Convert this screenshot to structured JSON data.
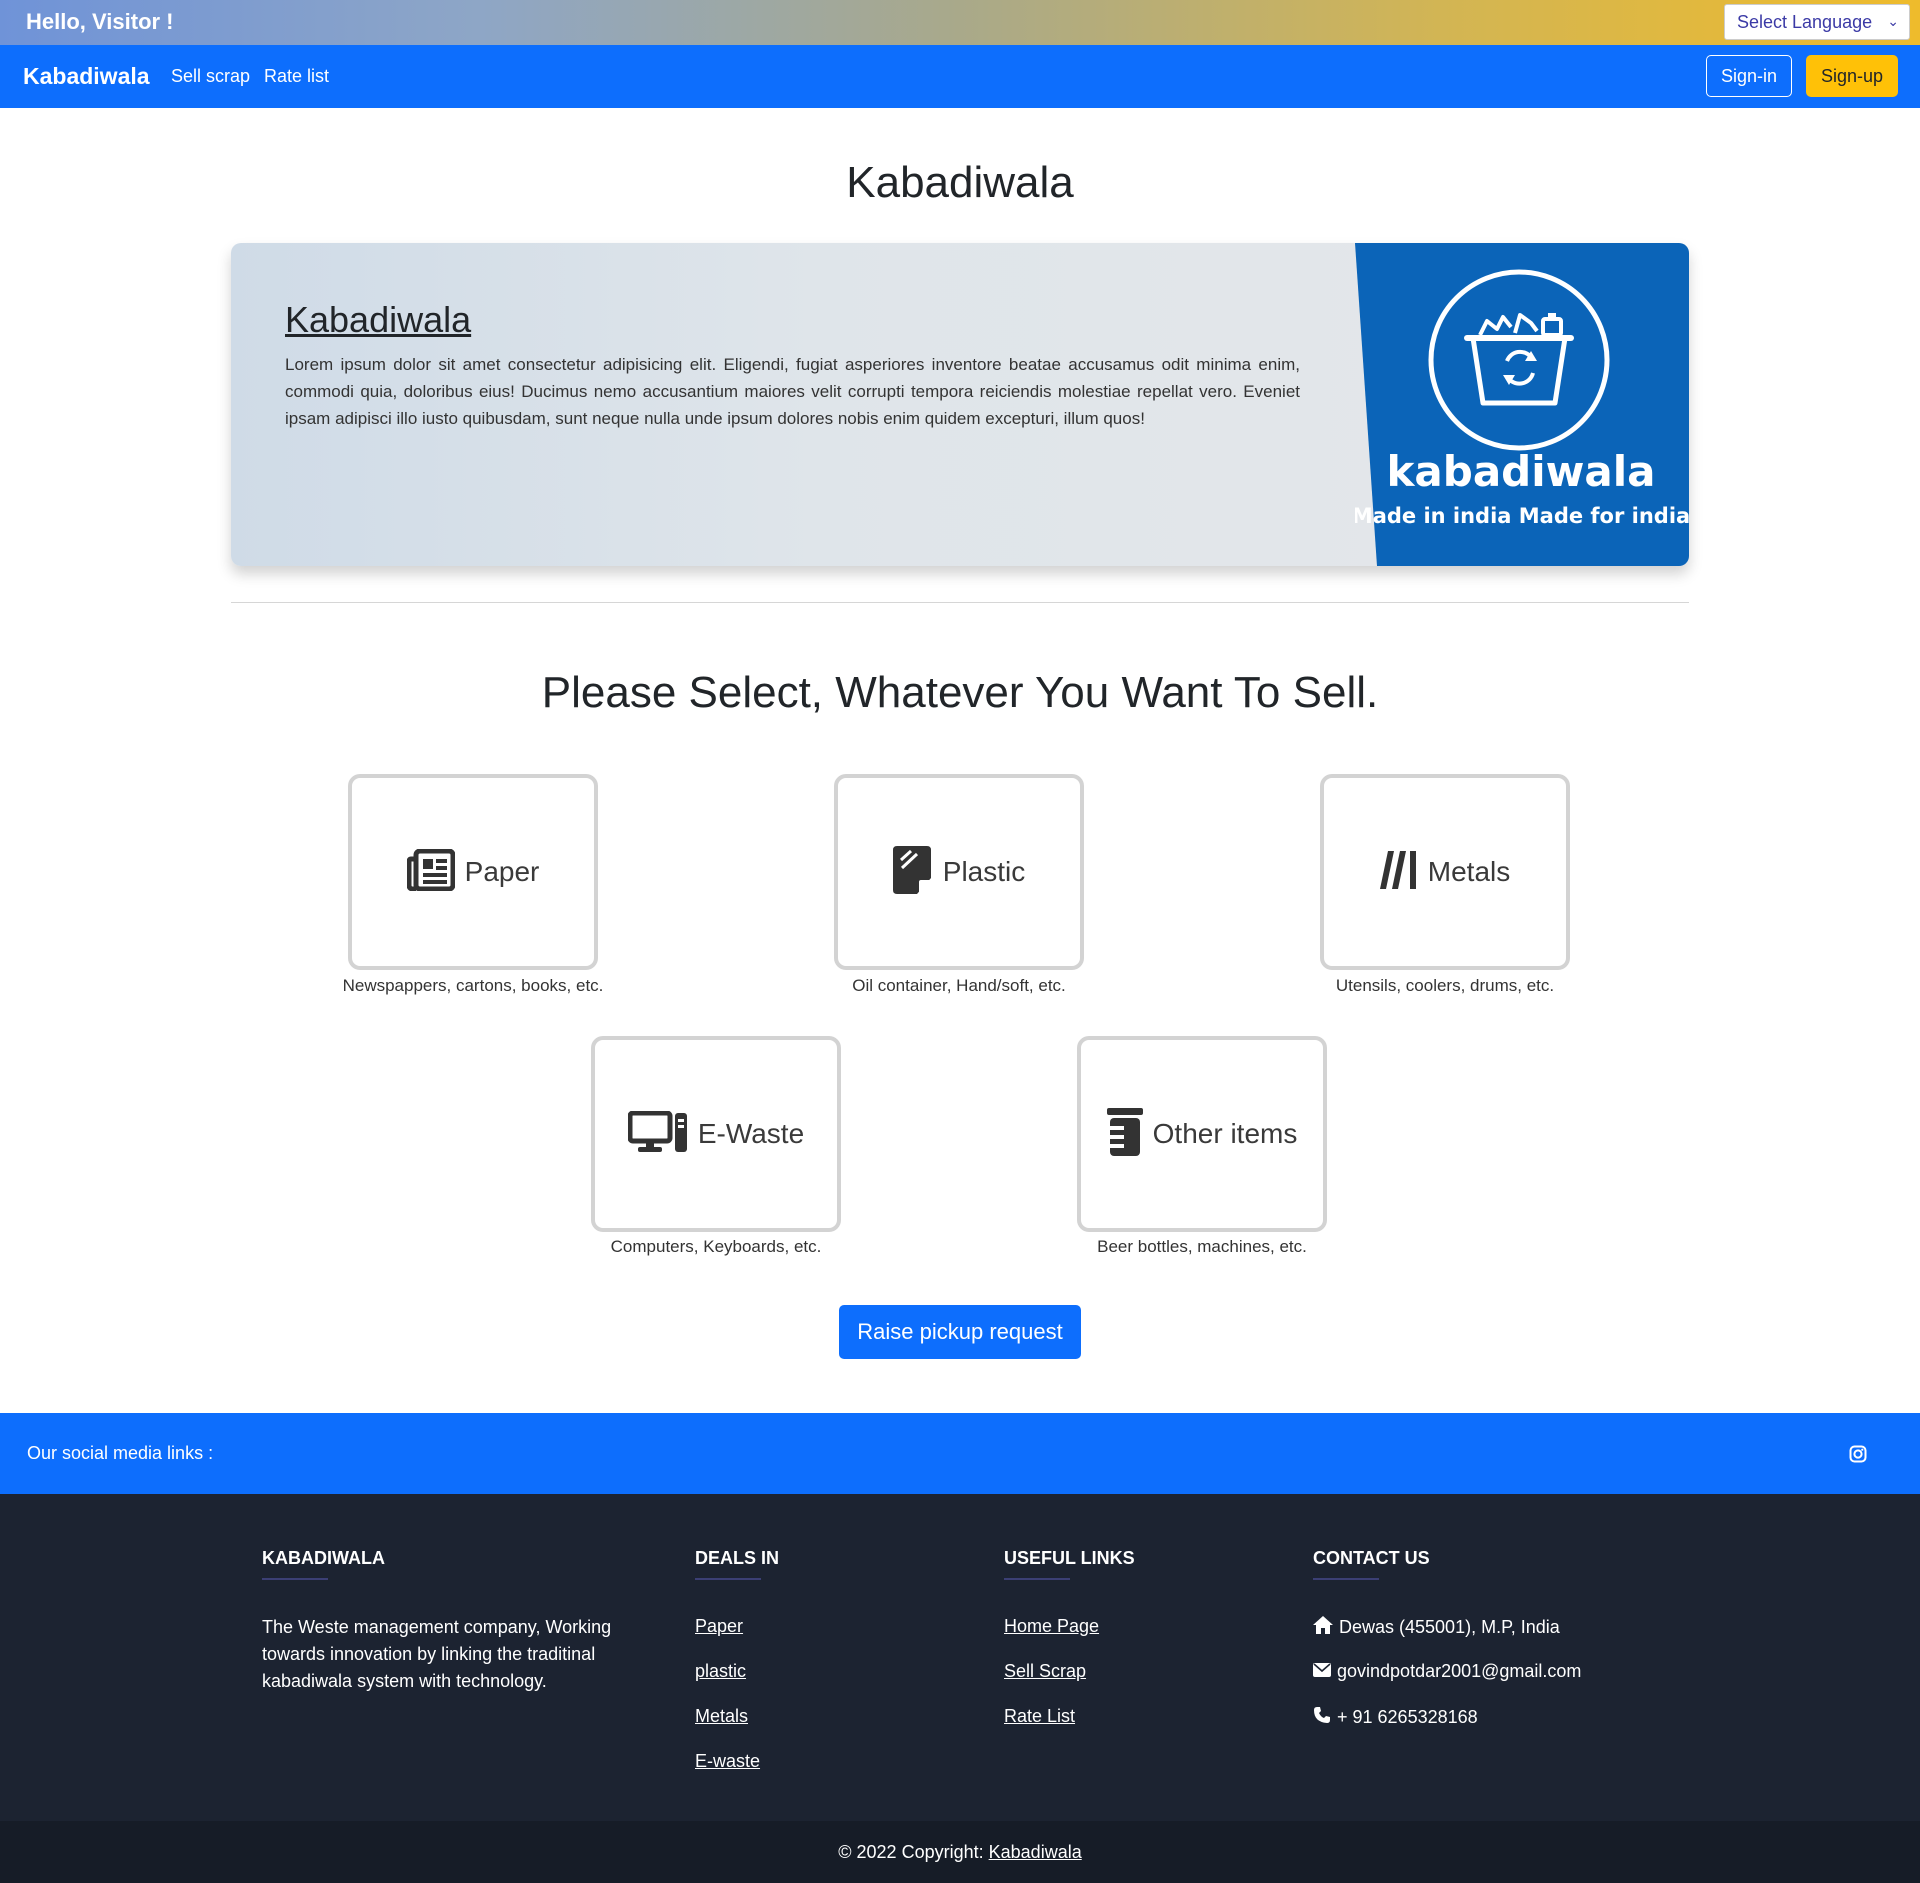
{
  "topbar": {
    "greeting": "Hello, Visitor !",
    "language_select": "Select Language"
  },
  "navbar": {
    "brand": "Kabadiwala",
    "links": [
      "Sell scrap",
      "Rate list"
    ],
    "signin": "Sign-in",
    "signup": "Sign-up"
  },
  "main": {
    "title": "Kabadiwala",
    "hero": {
      "heading": "Kabadiwala",
      "text": "Lorem ipsum dolor sit amet consectetur adipisicing elit. Eligendi, fugiat asperiores inventore beatae accusamus odit minima enim, commodi quia, doloribus eius! Ducimus nemo accusantium maiores velit corrupti tempora reiciendis molestiae repellat vero. Eveniet ipsam adipisci illo iusto quibusdam, sunt neque nulla unde ipsum dolores nobis enim quidem excepturi, illum quos!",
      "logo_name": "kabadiwala",
      "logo_tagline": "Made in india Made for india"
    },
    "select_title": "Please Select, Whatever You Want To Sell.",
    "categories": [
      {
        "label": "Paper",
        "desc": "Newspappers, cartons, books, etc.",
        "icon": "newspaper-icon"
      },
      {
        "label": "Plastic",
        "desc": "Oil container, Hand/soft, etc.",
        "icon": "note-sticky-icon"
      },
      {
        "label": "Metals",
        "desc": "Utensils, coolers, drums, etc.",
        "icon": "metal-bars-icon"
      },
      {
        "label": "E-Waste",
        "desc": "Computers, Keyboards, etc.",
        "icon": "computer-icon"
      },
      {
        "label": "Other items",
        "desc": "Beer bottles, machines, etc.",
        "icon": "jar-icon"
      }
    ],
    "raise_button": "Raise pickup request"
  },
  "social": {
    "text": "Our social media links :",
    "icon": "instagram-icon"
  },
  "footer": {
    "about": {
      "heading": "KABADIWALA",
      "text": "The Weste management company, Working towards innovation by linking the traditinal kabadiwala system with technology."
    },
    "deals": {
      "heading": "DEALS IN",
      "links": [
        "Paper",
        "plastic",
        "Metals",
        "E-waste"
      ]
    },
    "useful": {
      "heading": "USEFUL LINKS",
      "links": [
        "Home Page",
        "Sell Scrap",
        "Rate List"
      ]
    },
    "contact": {
      "heading": "CONTACT US",
      "address": "Dewas (455001), M.P, India",
      "email": "govindpotdar2001@gmail.com",
      "phone": "+ 91 6265328168"
    },
    "copyright_prefix": "© 2022 Copyright:",
    "copyright_link": "Kabadiwala"
  },
  "colors": {
    "primary": "#0d6efd",
    "warning": "#ffc107",
    "footer_bg": "#1c2331",
    "logo_bg": "#0b64b8"
  }
}
